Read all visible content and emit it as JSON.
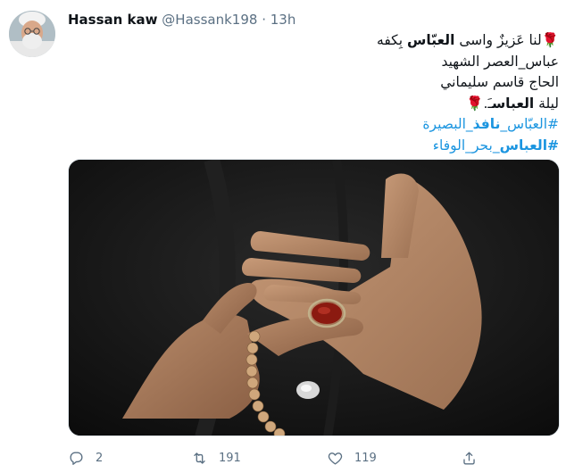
{
  "tweet": {
    "display_name": "Hassan kaw",
    "handle": "@Hassank198",
    "separator": "·",
    "time": "13h",
    "lines": [
      {
        "parts": [
          {
            "t": "🌹",
            "k": "rose"
          },
          {
            "t": "لنا عَزيزٌ واسى ",
            "k": "text"
          },
          {
            "t": "العبّاس",
            "k": "bold"
          },
          {
            "t": " بِكفه",
            "k": "text"
          }
        ]
      },
      {
        "parts": [
          {
            "t": "عباس_العصر  الشهيد",
            "k": "text"
          }
        ]
      },
      {
        "parts": [
          {
            "t": "الحاج قاسم سليماني",
            "k": "text"
          }
        ]
      },
      {
        "parts": [
          {
            "t": "ليلة ",
            "k": "text"
          },
          {
            "t": "العباس",
            "k": "bold"
          },
          {
            "t": "ـَ.",
            "k": "text"
          },
          {
            "t": "🌹",
            "k": "rose"
          }
        ]
      },
      {
        "parts": [
          {
            "t": "#العبّاس_",
            "k": "hashtag"
          },
          {
            "t": "نافذ",
            "k": "hashtag-bold"
          },
          {
            "t": "_البصيرة",
            "k": "hashtag"
          }
        ]
      },
      {
        "parts": [
          {
            "t": "#العباس",
            "k": "hashtag-bold"
          },
          {
            "t": "_بحر_الوفاء",
            "k": "hashtag"
          }
        ]
      }
    ],
    "media_alt": "photo"
  },
  "actions": {
    "reply_count": "2",
    "retweet_count": "191",
    "like_count": "119"
  },
  "colors": {
    "link": "#1b95e0",
    "muted": "#5b7083",
    "text": "#0f1419"
  },
  "icons": {
    "reply": "reply-icon",
    "retweet": "retweet-icon",
    "like": "heart-icon",
    "share": "share-icon"
  }
}
